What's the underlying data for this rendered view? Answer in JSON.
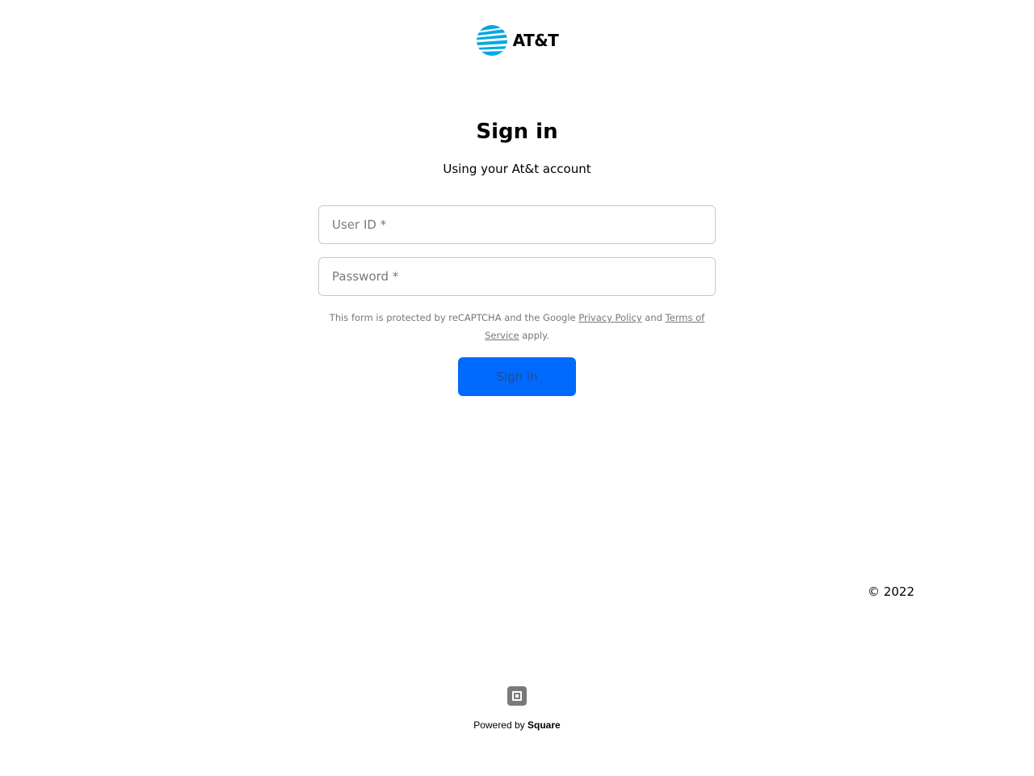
{
  "brand": {
    "logo_text": "AT&T",
    "logo_color": "#00a8e0"
  },
  "form": {
    "title": "Sign in",
    "subtitle": "Using your At&t account",
    "user_id_placeholder": "User ID *",
    "password_placeholder": "Password *",
    "recaptcha_prefix": "This form is protected by reCAPTCHA and the Google",
    "privacy_link": "Privacy Policy",
    "recaptcha_and": "and",
    "terms_link": "Terms of Service",
    "recaptcha_suffix": "apply.",
    "submit_label": "Sign in",
    "button_color": "#006aff"
  },
  "footer": {
    "copyright": "© 2022",
    "powered_by": "Powered by",
    "powered_brand": "Square",
    "icon": "square-logo-icon"
  }
}
